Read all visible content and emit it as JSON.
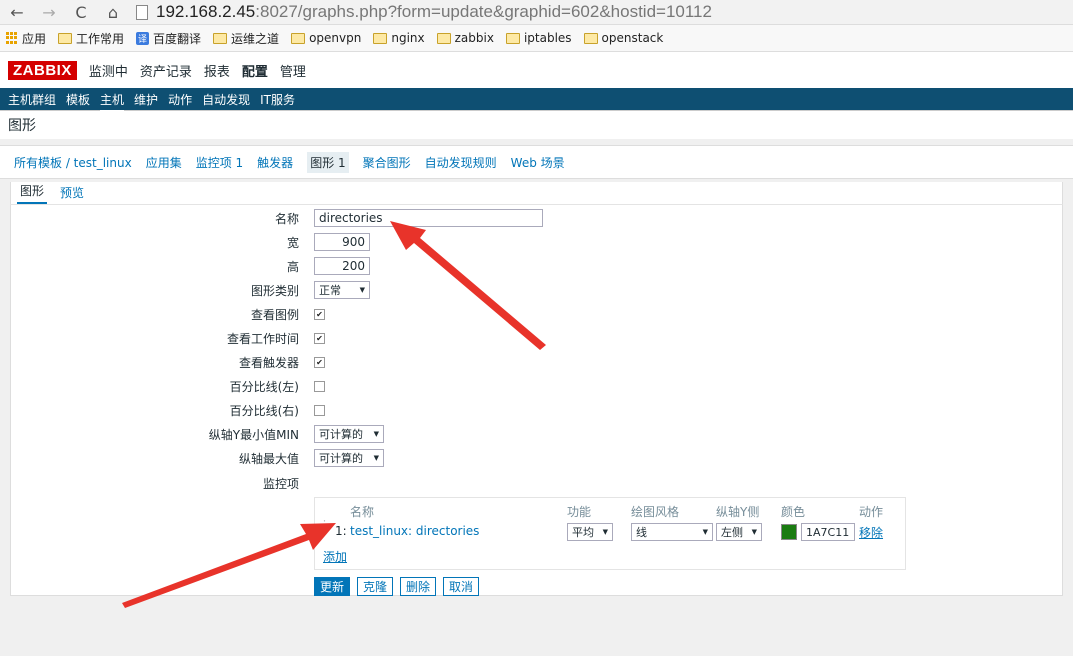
{
  "browser": {
    "url_host": "192.168.2.45",
    "url_rest": ":8027/graphs.php?form=update&graphid=602&hostid=10112"
  },
  "bookmarks": [
    {
      "label": "应用",
      "icon": "apps-icon"
    },
    {
      "label": "工作常用",
      "icon": "folder-icon"
    },
    {
      "label": "百度翻译",
      "icon": "translate-icon"
    },
    {
      "label": "运维之道",
      "icon": "folder-icon"
    },
    {
      "label": "openvpn",
      "icon": "folder-icon"
    },
    {
      "label": "nginx",
      "icon": "folder-icon"
    },
    {
      "label": "zabbix",
      "icon": "folder-icon"
    },
    {
      "label": "iptables",
      "icon": "folder-icon"
    },
    {
      "label": "openstack",
      "icon": "folder-icon"
    }
  ],
  "topnav": {
    "logo": "ZABBIX",
    "items": [
      "监测中",
      "资产记录",
      "报表",
      "配置",
      "管理"
    ]
  },
  "subnav": {
    "items": [
      "主机群组",
      "模板",
      "主机",
      "维护",
      "动作",
      "自动发现",
      "IT服务"
    ]
  },
  "page_title": "图形",
  "breadcrumbs": [
    "所有模板 / test_linux",
    "应用集",
    "监控项 1",
    "触发器",
    "图形 1",
    "聚合图形",
    "自动发现规则",
    "Web 场景"
  ],
  "tabs": [
    "图形",
    "预览"
  ],
  "form": {
    "name_label": "名称",
    "name_value": "directories",
    "width_label": "宽",
    "width_value": "900",
    "height_label": "高",
    "height_value": "200",
    "graph_type_label": "图形类别",
    "graph_type_value": "正常",
    "show_legend_label": "查看图例",
    "show_worktime_label": "查看工作时间",
    "show_triggers_label": "查看触发器",
    "percentile_left_label": "百分比线(左)",
    "percentile_right_label": "百分比线(右)",
    "ymin_label": "纵轴Y最小值MIN",
    "ymin_value": "可计算的",
    "ymax_label": "纵轴最大值",
    "ymax_value": "可计算的",
    "items_label": "监控项"
  },
  "items_table": {
    "headers": [
      "名称",
      "功能",
      "绘图风格",
      "纵轴Y侧",
      "颜色",
      "动作"
    ],
    "row": {
      "index": "1:",
      "name": "test_linux: directories",
      "function": "平均",
      "style": "线",
      "yaxis": "左侧",
      "color_hex": "1A7C11",
      "action": "移除"
    },
    "add": "添加"
  },
  "buttons": {
    "update": "更新",
    "clone": "克隆",
    "delete": "删除",
    "cancel": "取消"
  },
  "colors": {
    "accent": "#0275b8",
    "header_bar": "#0e4f72",
    "logo_red": "#d40000",
    "item_color": "#1A7C11",
    "annotation_arrow": "#e8332a"
  }
}
